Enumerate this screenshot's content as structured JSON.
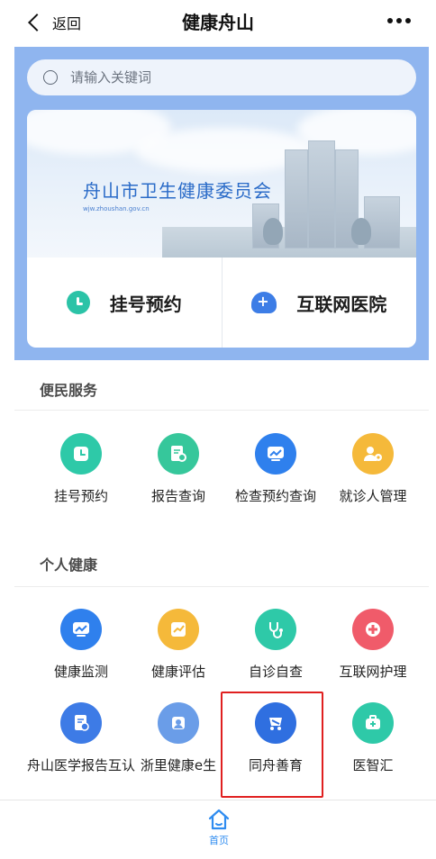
{
  "nav": {
    "back_label": "返回",
    "title": "健康舟山"
  },
  "search": {
    "placeholder": "请输入关键词"
  },
  "banner": {
    "org_name": "舟山市卫生健康委员会",
    "url": "wjw.zhoushan.gov.cn"
  },
  "quick_links": [
    {
      "label": "挂号预约",
      "icon": "clock-icon",
      "color": "#2bc3a7"
    },
    {
      "label": "互联网医院",
      "icon": "hospital-plus-icon",
      "color": "#3d7de6"
    }
  ],
  "sections": [
    {
      "title": "便民服务",
      "items": [
        {
          "label": "挂号预约",
          "icon": "clock-icon",
          "color": "#2ec9a8"
        },
        {
          "label": "报告查询",
          "icon": "report-search-icon",
          "color": "#36c79b"
        },
        {
          "label": "检查预约查询",
          "icon": "chart-monitor-icon",
          "color": "#2f80ed"
        },
        {
          "label": "就诊人管理",
          "icon": "person-gear-icon",
          "color": "#f5b93a"
        }
      ]
    },
    {
      "title": "个人健康",
      "items": [
        {
          "label": "健康监测",
          "icon": "chart-monitor-icon",
          "color": "#2f80ed"
        },
        {
          "label": "健康评估",
          "icon": "chart-card-icon",
          "color": "#f5b93a"
        },
        {
          "label": "自诊自查",
          "icon": "stethoscope-icon",
          "color": "#2ec9a8"
        },
        {
          "label": "互联网护理",
          "icon": "nurse-cross-icon",
          "color": "#f05b6a"
        },
        {
          "label": "舟山医学报告互认",
          "icon": "report-check-icon",
          "color": "#3d7be6"
        },
        {
          "label": "浙里健康e生",
          "icon": "doctor-icon",
          "color": "#6a9de8"
        },
        {
          "label": "同舟善育",
          "icon": "stroller-icon",
          "color": "#2f6fe0"
        },
        {
          "label": "医智汇",
          "icon": "medkit-icon",
          "color": "#2ec9a8"
        }
      ]
    }
  ],
  "tabbar": {
    "home_label": "首页",
    "accent": "#2f8cf0"
  },
  "highlight_color": "#e02020"
}
